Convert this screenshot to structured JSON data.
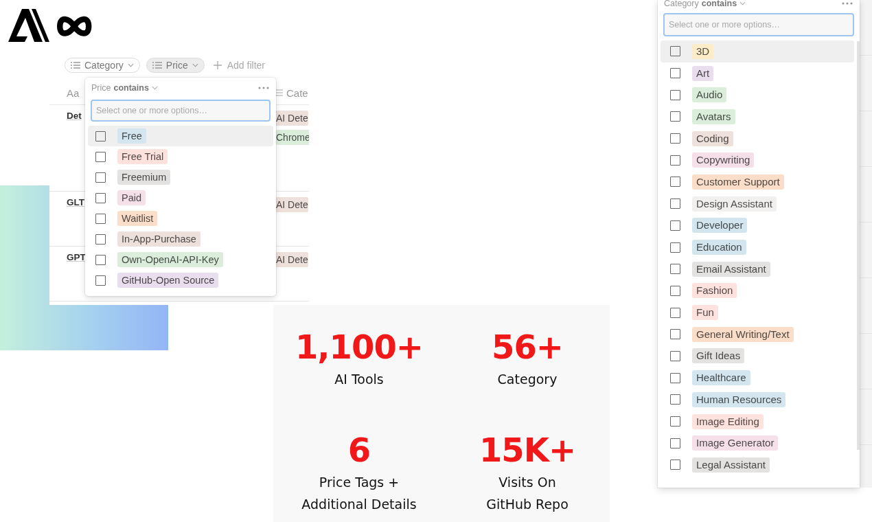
{
  "database": {
    "filters": [
      {
        "label": "Category",
        "selected": false
      },
      {
        "label": "Price",
        "selected": true
      }
    ],
    "add_filter": "Add filter",
    "columns": [
      {
        "label": "Aa",
        "kind": "title"
      },
      {
        "label": "Cate",
        "kind": "list"
      }
    ],
    "rows": [
      {
        "name": "Det",
        "tags": [
          {
            "label": "AI Dete",
            "color": "#eee0da"
          },
          {
            "label": "Chrome",
            "color": "#dbeddb"
          }
        ]
      },
      {
        "name": "GLT",
        "tags": [
          {
            "label": "AI Dete",
            "color": "#eee0da"
          }
        ]
      },
      {
        "name": "GPT",
        "tags": [
          {
            "label": "AI Dete",
            "color": "#eee0da"
          }
        ]
      }
    ]
  },
  "price_filter": {
    "property": "Price",
    "operator": "contains",
    "placeholder": "Select one or more options…",
    "options": [
      {
        "label": "Free",
        "color": "#d3e5ef",
        "checked": false,
        "selected": true
      },
      {
        "label": "Free Trial",
        "color": "#ffe2dd",
        "checked": false,
        "selected": false
      },
      {
        "label": "Freemium",
        "color": "#e3e2e0",
        "checked": false,
        "selected": false
      },
      {
        "label": "Paid",
        "color": "#f5e0e9",
        "checked": false,
        "selected": false
      },
      {
        "label": "Waitlist",
        "color": "#fadec9",
        "checked": false,
        "selected": false
      },
      {
        "label": "In-App-Purchase",
        "color": "#eee0da",
        "checked": false,
        "selected": false
      },
      {
        "label": "Own-OpenAI-API-Key",
        "color": "#dbeddb",
        "checked": false,
        "selected": false
      },
      {
        "label": "GitHub-Open Source",
        "color": "#e8deee",
        "checked": false,
        "selected": false
      }
    ]
  },
  "stats": [
    {
      "value": "1,100+",
      "lines": [
        "AI Tools"
      ]
    },
    {
      "value": "56+",
      "lines": [
        "Category"
      ]
    },
    {
      "value": "6",
      "lines": [
        "Price Tags +",
        "Additional Details"
      ]
    },
    {
      "value": "15K+",
      "lines": [
        "Visits On",
        "GitHub Repo"
      ]
    }
  ],
  "category_filter": {
    "property": "Category",
    "operator": "contains",
    "placeholder": "Select one or more options…",
    "options": [
      {
        "label": "3D",
        "color": "#fdecc8",
        "checked": false,
        "selected": true
      },
      {
        "label": "Art",
        "color": "#e8deee",
        "checked": false,
        "selected": false
      },
      {
        "label": "Audio",
        "color": "#dbeddb",
        "checked": false,
        "selected": false
      },
      {
        "label": "Avatars",
        "color": "#dbeddb",
        "checked": false,
        "selected": false
      },
      {
        "label": "Coding",
        "color": "#eee0da",
        "checked": false,
        "selected": false
      },
      {
        "label": "Copywriting",
        "color": "#f5e0e9",
        "checked": false,
        "selected": false
      },
      {
        "label": "Customer Support",
        "color": "#fadec9",
        "checked": false,
        "selected": false
      },
      {
        "label": "Design Assistant",
        "color": "#f1f0ef",
        "checked": false,
        "selected": false
      },
      {
        "label": "Developer",
        "color": "#d3e5ef",
        "checked": false,
        "selected": false
      },
      {
        "label": "Education",
        "color": "#d3e5ef",
        "checked": false,
        "selected": false
      },
      {
        "label": "Email Assistant",
        "color": "#e3e2e0",
        "checked": false,
        "selected": false
      },
      {
        "label": "Fashion",
        "color": "#ffe2dd",
        "checked": false,
        "selected": false
      },
      {
        "label": "Fun",
        "color": "#ffe2dd",
        "checked": false,
        "selected": false
      },
      {
        "label": "General Writing/Text",
        "color": "#fadec9",
        "checked": false,
        "selected": false
      },
      {
        "label": "Gift Ideas",
        "color": "#e3e2e0",
        "checked": false,
        "selected": false
      },
      {
        "label": "Healthcare",
        "color": "#d3e5ef",
        "checked": false,
        "selected": false
      },
      {
        "label": "Human Resources",
        "color": "#d3e5ef",
        "checked": false,
        "selected": false
      },
      {
        "label": "Image Editing",
        "color": "#ffe2dd",
        "checked": false,
        "selected": false
      },
      {
        "label": "Image Generator",
        "color": "#f5e0e9",
        "checked": false,
        "selected": false
      },
      {
        "label": "Legal Assistant",
        "color": "#e3e2e0",
        "checked": false,
        "selected": false
      }
    ]
  }
}
